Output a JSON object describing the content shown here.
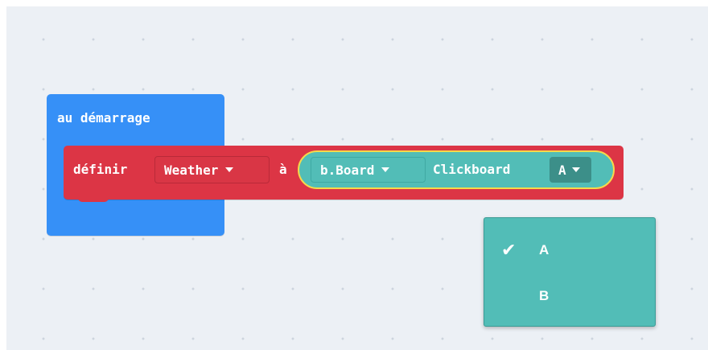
{
  "workspace": {
    "start_block": {
      "label": "au démarrage"
    },
    "set_block": {
      "label": "définir",
      "variable": "Weather",
      "to_label": "à",
      "value": {
        "board_dropdown": "b.Board",
        "name": "Clickboard",
        "slot_dropdown": "A"
      }
    }
  },
  "dropdown_menu": {
    "items": [
      {
        "label": "A",
        "selected": true
      },
      {
        "label": "B",
        "selected": false
      }
    ]
  },
  "colors": {
    "workspace_bg": "#ecf0f5",
    "start_block": "#3690f7",
    "set_block": "#dc3545",
    "reporter": "#52bdb7",
    "reporter_highlight": "#f5d94b",
    "menu": "#52bdb7"
  },
  "icons": [
    "dropdown-caret-icon",
    "checkmark-icon"
  ]
}
